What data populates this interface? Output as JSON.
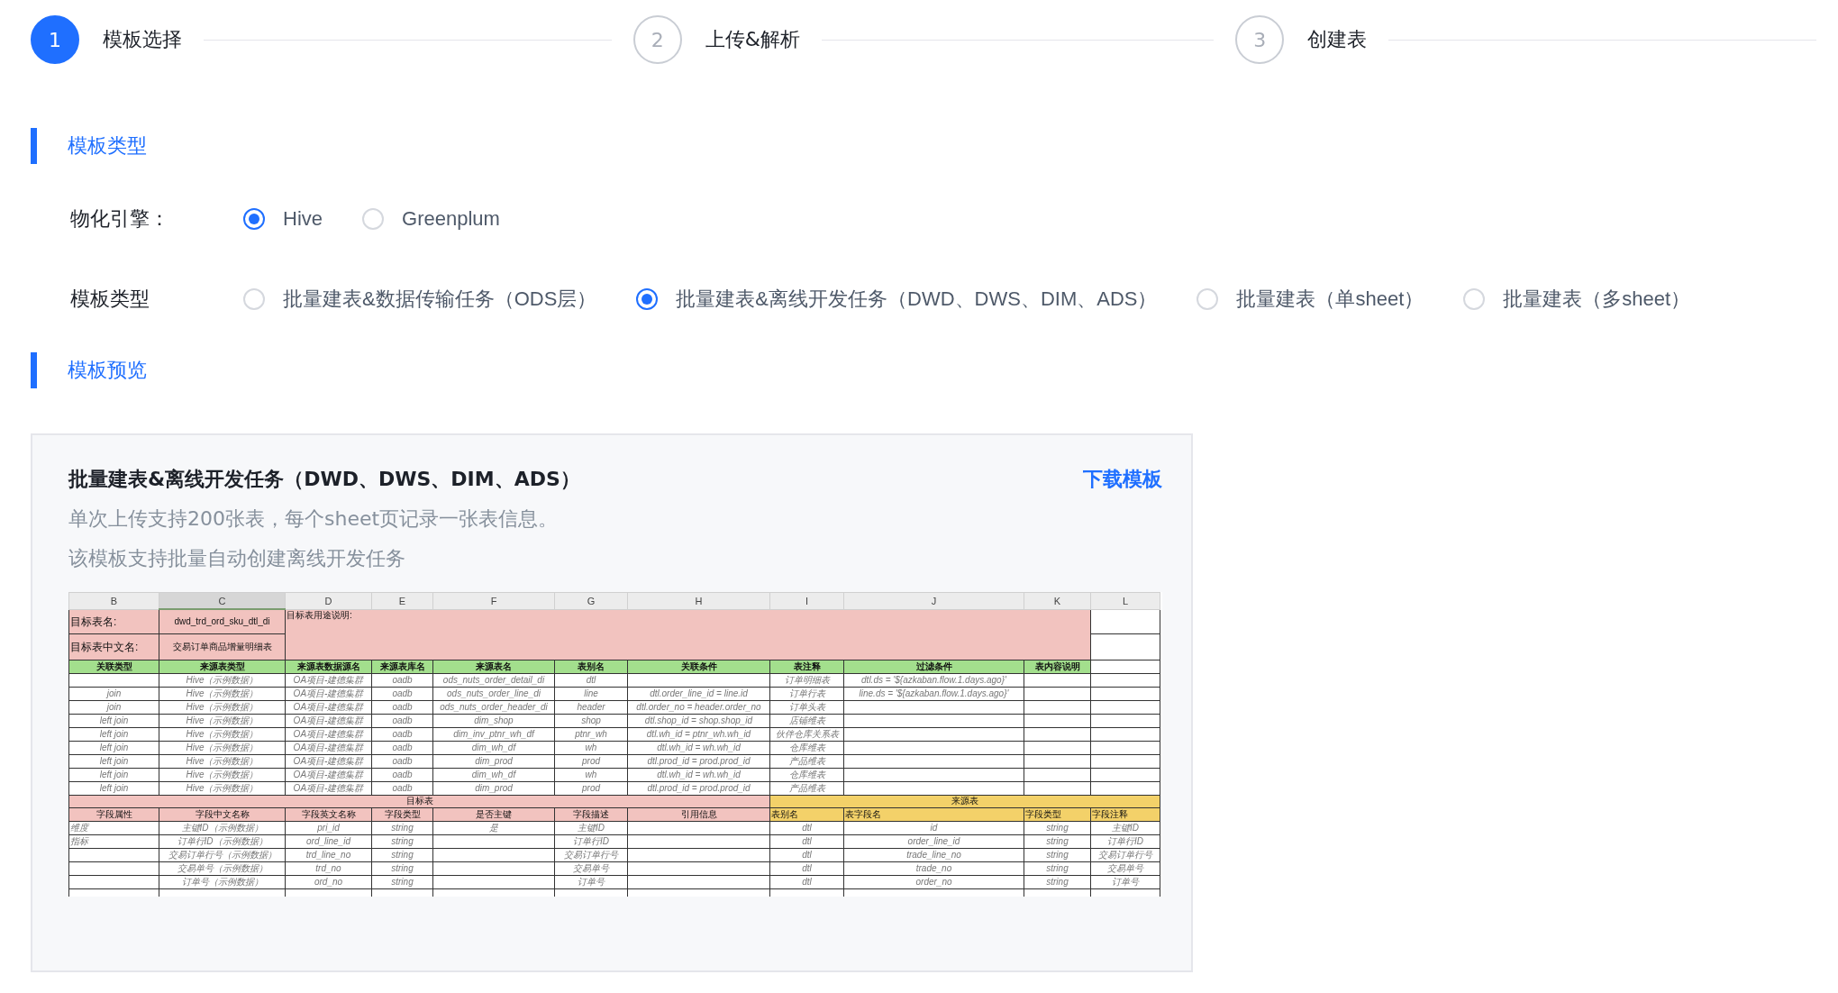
{
  "steps": [
    {
      "number": "1",
      "label": "模板选择",
      "selected": true
    },
    {
      "number": "2",
      "label": "上传&解析",
      "selected": false
    },
    {
      "number": "3",
      "label": "创建表",
      "selected": false
    }
  ],
  "template_section": {
    "title": "模板类型"
  },
  "engine": {
    "label": "物化引擎：",
    "options": [
      {
        "label": "Hive",
        "selected": true
      },
      {
        "label": "Greenplum",
        "selected": false
      }
    ]
  },
  "template_type": {
    "label": "模板类型",
    "options": [
      {
        "label": "批量建表&数据传输任务（ODS层）",
        "selected": false
      },
      {
        "label": "批量建表&离线开发任务（DWD、DWS、DIM、ADS）",
        "selected": true
      },
      {
        "label": "批量建表（单sheet）",
        "selected": false
      },
      {
        "label": "批量建表（多sheet）",
        "selected": false
      }
    ]
  },
  "preview_section": {
    "title": "模板预览"
  },
  "preview": {
    "title": "批量建表&离线开发任务（DWD、DWS、DIM、ADS）",
    "download": "下载模板",
    "description": [
      "单次上传支持200张表，每个sheet页记录一张表信息。",
      "该模板支持批量自动创建离线开发任务"
    ],
    "spreadsheet": {
      "columns": [
        {
          "label": "B",
          "selected": false
        },
        {
          "label": "C",
          "selected": true
        },
        {
          "label": "D",
          "selected": false
        },
        {
          "label": "E",
          "selected": false
        },
        {
          "label": "F",
          "selected": false
        },
        {
          "label": "G",
          "selected": false
        },
        {
          "label": "H",
          "selected": false
        },
        {
          "label": "I",
          "selected": false
        },
        {
          "label": "J",
          "selected": false
        },
        {
          "label": "K",
          "selected": false
        },
        {
          "label": "L",
          "selected": false
        }
      ],
      "target_name_label": "目标表名:",
      "target_name_value": "dwd_trd_ord_sku_dtl_di",
      "purpose_label": "目标表用途说明:",
      "cn_name_label": "目标表中文名:",
      "cn_name_value": "交易订单商品增量明细表",
      "source_header": [
        "关联类型",
        "来源表类型",
        "来源表数据源名",
        "来源表库名",
        "来源表名",
        "表别名",
        "关联条件",
        "表注释",
        "过滤条件",
        "表内容说明"
      ],
      "source_rows": [
        [
          "",
          "Hive（示例数据）",
          "OA项目-建德集群",
          "oadb",
          "ods_nuts_order_detail_di",
          "dtl",
          "",
          "订单明细表",
          "dtl.ds = '${azkaban.flow.1.days.ago}'"
        ],
        [
          "join",
          "Hive（示例数据）",
          "OA项目-建德集群",
          "oadb",
          "ods_nuts_order_line_di",
          "line",
          "dtl.order_line_id = line.id",
          "订单行表",
          "line.ds = '${azkaban.flow.1.days.ago}'"
        ],
        [
          "join",
          "Hive（示例数据）",
          "OA项目-建德集群",
          "oadb",
          "ods_nuts_order_header_di",
          "header",
          "dtl.order_no = header.order_no",
          "订单头表",
          ""
        ],
        [
          "left join",
          "Hive（示例数据）",
          "OA项目-建德集群",
          "oadb",
          "dim_shop",
          "shop",
          "dtl.shop_id = shop.shop_id",
          "店铺维表",
          ""
        ],
        [
          "left join",
          "Hive（示例数据）",
          "OA项目-建德集群",
          "oadb",
          "dim_inv_ptnr_wh_df",
          "ptnr_wh",
          "dtl.wh_id = ptnr_wh.wh_id",
          "伙伴仓库关系表",
          ""
        ],
        [
          "left join",
          "Hive（示例数据）",
          "OA项目-建德集群",
          "oadb",
          "dim_wh_df",
          "wh",
          "dtl.wh_id = wh.wh_id",
          "仓库维表",
          ""
        ],
        [
          "left join",
          "Hive（示例数据）",
          "OA项目-建德集群",
          "oadb",
          "dim_prod",
          "prod",
          "dtl.prod_id = prod.prod_id",
          "产品维表",
          ""
        ],
        [
          "left join",
          "Hive（示例数据）",
          "OA项目-建德集群",
          "oadb",
          "dim_wh_df",
          "wh",
          "dtl.wh_id = wh.wh_id",
          "仓库维表",
          ""
        ],
        [
          "left join",
          "Hive（示例数据）",
          "OA项目-建德集群",
          "oadb",
          "dim_prod",
          "prod",
          "dtl.prod_id = prod.prod_id",
          "产品维表",
          ""
        ]
      ],
      "target_band": "目标表",
      "source_band": "来源表",
      "field_header": [
        "字段属性",
        "字段中文名称",
        "字段英文名称",
        "字段类型",
        "是否主键",
        "字段描述",
        "引用信息",
        "表别名",
        "表字段名",
        "字段类型",
        "字段注释"
      ],
      "field_rows": [
        [
          "维度",
          "主键ID（示例数据）",
          "pri_id",
          "string",
          "是",
          "主键ID",
          "",
          "dtl",
          "id",
          "string",
          "主键ID"
        ],
        [
          "指标",
          "订单行ID（示例数据）",
          "ord_line_id",
          "string",
          "",
          "订单行ID",
          "",
          "dtl",
          "order_line_id",
          "string",
          "订单行ID"
        ],
        [
          "",
          "交易订单行号（示例数据）",
          "trd_line_no",
          "string",
          "",
          "交易订单行号",
          "",
          "dtl",
          "trade_line_no",
          "string",
          "交易订单行号"
        ],
        [
          "",
          "交易单号（示例数据）",
          "trd_no",
          "string",
          "",
          "交易单号",
          "",
          "dtl",
          "trade_no",
          "string",
          "交易单号"
        ],
        [
          "",
          "订单号（示例数据）",
          "ord_no",
          "string",
          "",
          "订单号",
          "",
          "dtl",
          "order_no",
          "string",
          "订单号"
        ]
      ]
    }
  }
}
